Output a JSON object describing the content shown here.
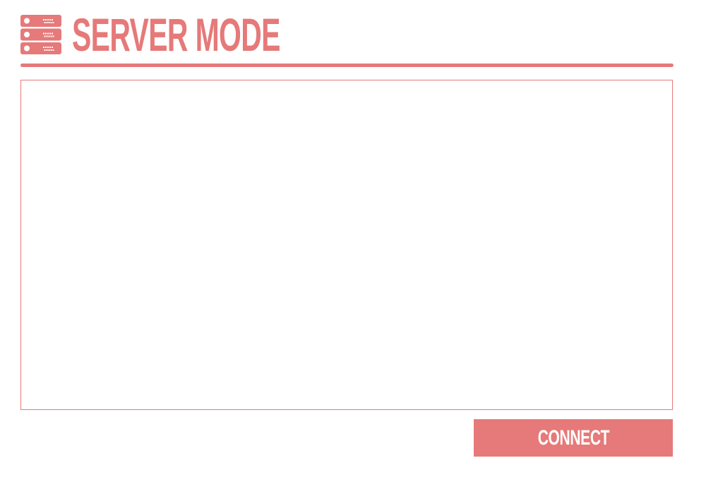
{
  "header": {
    "icon": "server-icon",
    "title": "SERVER MODE"
  },
  "log_panel": {
    "content": ""
  },
  "connect_button": {
    "label": "CONNECT"
  },
  "colors": {
    "accent": "#e67979",
    "background": "#ffffff",
    "button_text": "#ffffff"
  }
}
